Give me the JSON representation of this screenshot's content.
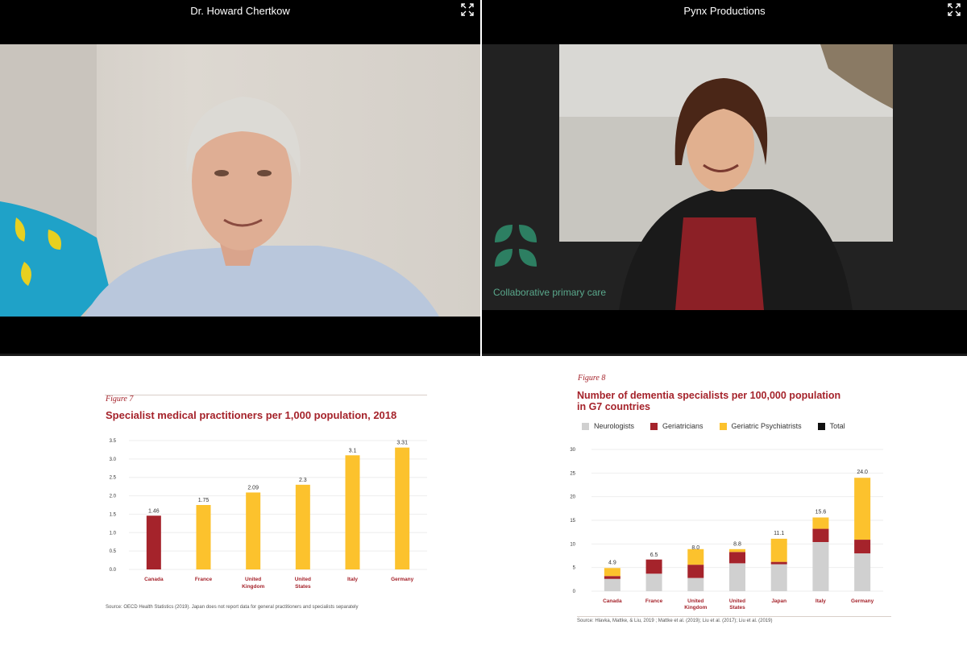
{
  "participants": [
    {
      "name": "Dr. Howard Chertkow"
    },
    {
      "name": "Pynx Productions",
      "logo_tagline": "Collaborative primary care"
    }
  ],
  "colors": {
    "red": "#a5232b",
    "yellow": "#fcc22d",
    "gray": "#d0d0d0",
    "black": "#111111"
  },
  "icons": {
    "fullscreen": "fullscreen-icon"
  },
  "figure7": {
    "label": "Figure 7",
    "title": "Specialist medical practitioners per 1,000 population, 2018",
    "source": "Source: OECD Health Statistics (2019). Japan does not report data for general practitioners and specialists separately"
  },
  "figure8": {
    "label": "Figure 8",
    "title_line1": "Number of dementia specialists per 100,000 population",
    "title_line2": "in G7 countries",
    "source": "Source: Hlavka, Mattke, & Liu, 2019 ; Mattke et al. (2019); Liu et al. (2017); Liu et al. (2019)"
  },
  "chart_data": [
    {
      "type": "bar",
      "title": "Specialist medical practitioners per 1,000 population, 2018",
      "categories": [
        [
          "Canada"
        ],
        [
          "France"
        ],
        [
          "United",
          "Kingdom"
        ],
        [
          "United",
          "States"
        ],
        [
          "Italy"
        ],
        [
          "Germany"
        ]
      ],
      "values": [
        1.46,
        1.75,
        2.09,
        2.3,
        3.1,
        3.31
      ],
      "value_labels": [
        "1.46",
        "1.75",
        "2.09",
        "2.3",
        "3.1",
        "3.31"
      ],
      "bar_colors": [
        "#a5232b",
        "#fcc22d",
        "#fcc22d",
        "#fcc22d",
        "#fcc22d",
        "#fcc22d"
      ],
      "ylim": [
        0,
        3.5
      ],
      "yticks": [
        0,
        0.5,
        1.0,
        1.5,
        2.0,
        2.5,
        3.0,
        3.5
      ],
      "ytick_labels": [
        "0.0",
        "0.5",
        "1.0",
        "1.5",
        "2.0",
        "2.5",
        "3.0",
        "3.5"
      ]
    },
    {
      "type": "bar",
      "stacked": true,
      "title": "Number of dementia specialists per 100,000 population in G7 countries",
      "categories": [
        [
          "Canada"
        ],
        [
          "France"
        ],
        [
          "United",
          "Kingdom"
        ],
        [
          "United",
          "States"
        ],
        [
          "Japan"
        ],
        [
          "Italy"
        ],
        [
          "Germany"
        ]
      ],
      "series": [
        {
          "name": "Neurologists",
          "color": "#d0d0d0",
          "values": [
            2.6,
            3.7,
            2.8,
            5.9,
            5.7,
            10.4,
            8.0
          ]
        },
        {
          "name": "Geriatricians",
          "color": "#a5232b",
          "values": [
            0.6,
            3.0,
            2.8,
            2.4,
            0.5,
            2.8,
            2.9
          ]
        },
        {
          "name": "Geriatric Psychiatrists",
          "color": "#fcc22d",
          "values": [
            1.7,
            0.0,
            3.3,
            0.6,
            4.9,
            2.4,
            13.1
          ]
        }
      ],
      "legend": [
        {
          "name": "Neurologists",
          "color": "#d0d0d0"
        },
        {
          "name": "Geriatricians",
          "color": "#a5232b"
        },
        {
          "name": "Geriatric Psychiatrists",
          "color": "#fcc22d"
        },
        {
          "name": "Total",
          "color": "#111111"
        }
      ],
      "totals": [
        4.9,
        6.5,
        8.0,
        8.8,
        11.1,
        15.6,
        24.0
      ],
      "total_labels": [
        "4.9",
        "6.5",
        "8.0",
        "8.8",
        "11.1",
        "15.6",
        "24.0"
      ],
      "ylim": [
        0,
        30
      ],
      "yticks": [
        0,
        5,
        10,
        15,
        20,
        25,
        30
      ],
      "ytick_labels": [
        "0",
        "5",
        "10",
        "15",
        "20",
        "25",
        "30"
      ],
      "legend_position": "top-left"
    }
  ]
}
